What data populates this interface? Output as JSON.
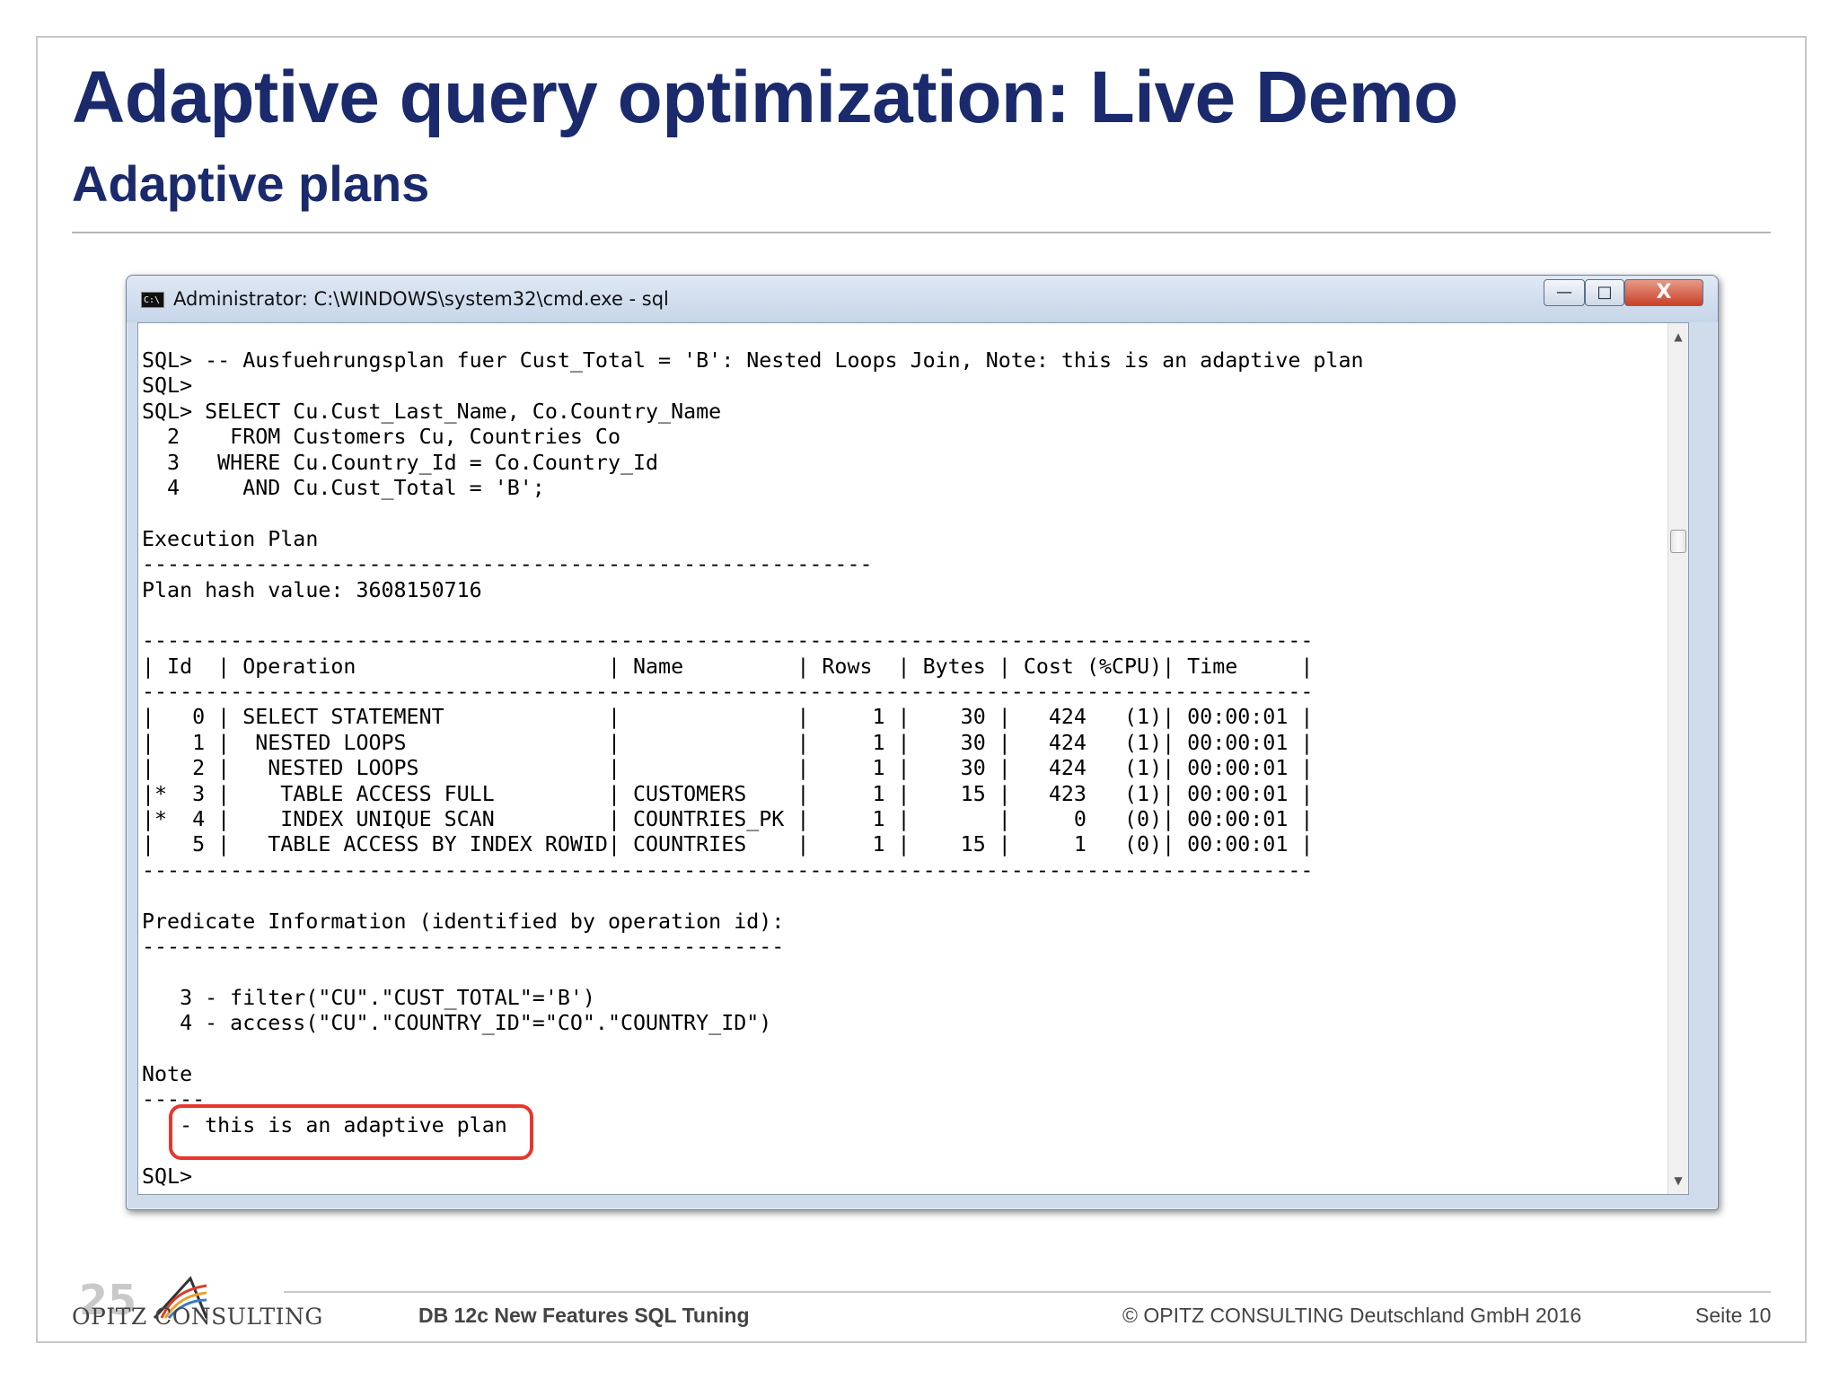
{
  "slide": {
    "title": "Adaptive query optimization: Live Demo",
    "subtitle": "Adaptive plans"
  },
  "window": {
    "title": "Administrator: C:\\WINDOWS\\system32\\cmd.exe - sql",
    "minimize_label": "—",
    "maximize_label": "□",
    "close_label": "X"
  },
  "console": {
    "lines": [
      "SQL> -- Ausfuehrungsplan fuer Cust_Total = 'B': Nested Loops Join, Note: this is an adaptive plan",
      "SQL>",
      "SQL> SELECT Cu.Cust_Last_Name, Co.Country_Name",
      "  2    FROM Customers Cu, Countries Co",
      "  3   WHERE Cu.Country_Id = Co.Country_Id",
      "  4     AND Cu.Cust_Total = 'B';",
      "",
      "Execution Plan",
      "----------------------------------------------------------",
      "Plan hash value: 3608150716",
      "",
      "---------------------------------------------------------------------------------------------",
      "| Id  | Operation                    | Name         | Rows  | Bytes | Cost (%CPU)| Time     |",
      "---------------------------------------------------------------------------------------------",
      "|   0 | SELECT STATEMENT             |              |     1 |    30 |   424   (1)| 00:00:01 |",
      "|   1 |  NESTED LOOPS                |              |     1 |    30 |   424   (1)| 00:00:01 |",
      "|   2 |   NESTED LOOPS               |              |     1 |    30 |   424   (1)| 00:00:01 |",
      "|*  3 |    TABLE ACCESS FULL         | CUSTOMERS    |     1 |    15 |   423   (1)| 00:00:01 |",
      "|*  4 |    INDEX UNIQUE SCAN         | COUNTRIES_PK |     1 |       |     0   (0)| 00:00:01 |",
      "|   5 |   TABLE ACCESS BY INDEX ROWID| COUNTRIES    |     1 |    15 |     1   (0)| 00:00:01 |",
      "---------------------------------------------------------------------------------------------",
      "",
      "Predicate Information (identified by operation id):",
      "---------------------------------------------------",
      "",
      "   3 - filter(\"CU\".\"CUST_TOTAL\"='B')",
      "   4 - access(\"CU\".\"COUNTRY_ID\"=\"CO\".\"COUNTRY_ID\")",
      "",
      "Note",
      "-----",
      "   - this is an adaptive plan",
      "",
      "SQL>"
    ]
  },
  "footer": {
    "logo_company": "OPITZ CONSULTING",
    "left_text": "DB 12c New Features SQL Tuning",
    "right_text": "© OPITZ CONSULTING Deutschland GmbH 2016",
    "page_label": "Seite 10"
  },
  "colors": {
    "title": "#1a2a6c",
    "highlight": "#e8362b"
  },
  "icons": {
    "cmd": "cmd-icon",
    "logo": "opitz-logo-icon"
  }
}
